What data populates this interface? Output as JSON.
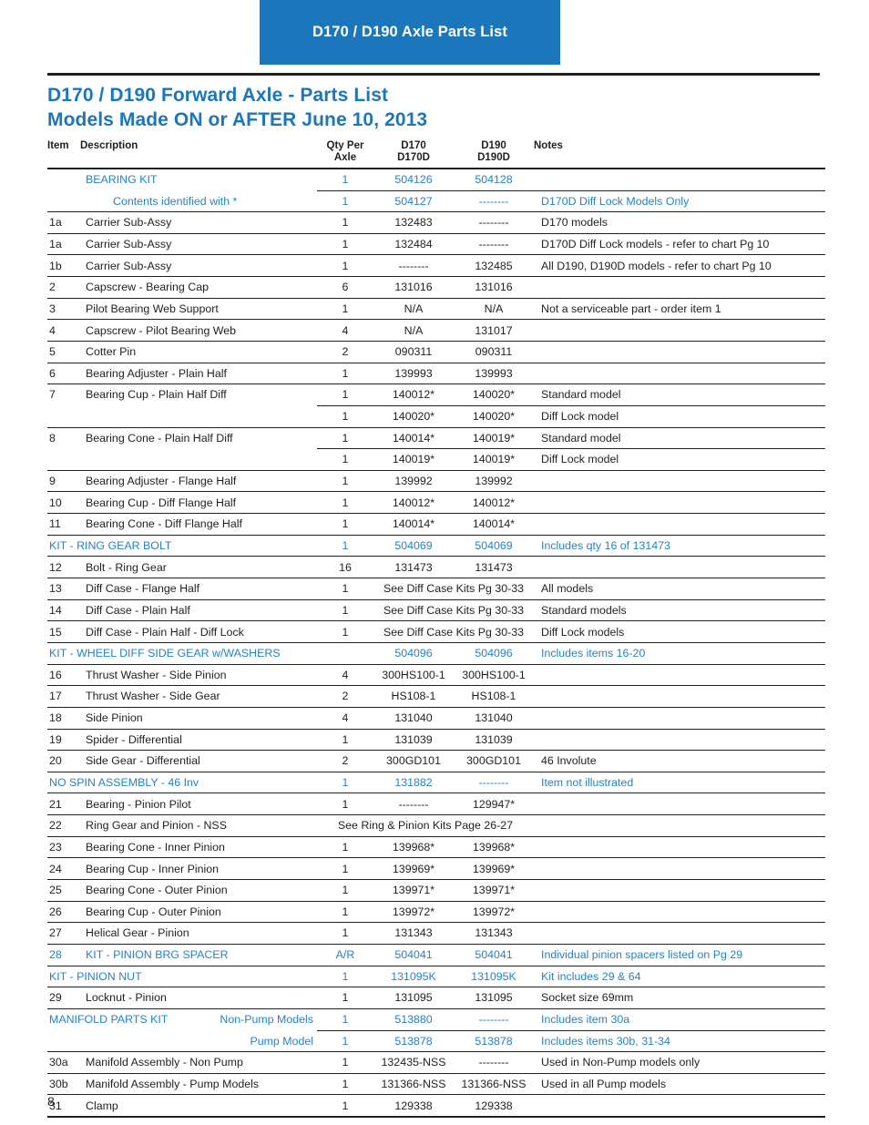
{
  "banner": {
    "title": "D170 / D190 Axle Parts List"
  },
  "document": {
    "title_line1": "D170 / D190 Forward Axle - Parts List",
    "title_line2": "Models Made ON or AFTER June 10, 2013",
    "page_number": "8",
    "accent_blue": "#1b76bc",
    "link_blue": "#2583c6",
    "rule_color": "#231f20"
  },
  "table": {
    "headers": {
      "item": "Item",
      "description": "Description",
      "qty_line1": "Qty Per",
      "qty_line2": "Axle",
      "d170_line1": "D170",
      "d170_line2": "D170D",
      "d190_line1": "D190",
      "d190_line2": "D190D",
      "notes": "Notes"
    },
    "rows": [
      {
        "item": "",
        "desc": "BEARING KIT",
        "qty": "1",
        "d170": "504126",
        "d190": "504128",
        "notes": "",
        "kit": true,
        "left_rule": false
      },
      {
        "item": "",
        "desc": "Contents identified with *",
        "qty": "1",
        "d170": "504127",
        "d190": "--------",
        "notes": "D170D Diff Lock Models Only",
        "kit": true,
        "indent": true
      },
      {
        "item": "1a",
        "desc": "Carrier Sub-Assy",
        "qty": "1",
        "d170": "132483",
        "d190": "--------",
        "notes": "D170 models"
      },
      {
        "item": "1a",
        "desc": "Carrier Sub-Assy",
        "qty": "1",
        "d170": "132484",
        "d190": "--------",
        "notes": "D170D Diff Lock models - refer to chart Pg 10"
      },
      {
        "item": "1b",
        "desc": "Carrier Sub-Assy",
        "qty": "1",
        "d170": "--------",
        "d190": "132485",
        "notes": "All D190, D190D models - refer to chart Pg 10"
      },
      {
        "item": "2",
        "desc": "Capscrew - Bearing Cap",
        "qty": "6",
        "d170": "131016",
        "d190": "131016",
        "notes": ""
      },
      {
        "item": "3",
        "desc": "Pilot Bearing Web Support",
        "qty": "1",
        "d170": "N/A",
        "d190": "N/A",
        "notes": "Not a serviceable part - order item 1"
      },
      {
        "item": "4",
        "desc": "Capscrew - Pilot Bearing Web",
        "qty": "4",
        "d170": "N/A",
        "d190": "131017",
        "notes": ""
      },
      {
        "item": "5",
        "desc": "Cotter Pin",
        "qty": "2",
        "d170": "090311",
        "d190": "090311",
        "notes": ""
      },
      {
        "item": "6",
        "desc": "Bearing Adjuster - Plain Half",
        "qty": "1",
        "d170": "139993",
        "d190": "139993",
        "notes": ""
      },
      {
        "item": "7",
        "desc": "Bearing Cup - Plain Half Diff",
        "qty": "1",
        "d170": "140012*",
        "d190": "140020*",
        "notes": "Standard model",
        "left_rule": false
      },
      {
        "item": "",
        "desc": "",
        "qty": "1",
        "d170": "140020*",
        "d190": "140020*",
        "notes": "Diff Lock model"
      },
      {
        "item": "8",
        "desc": "Bearing Cone - Plain Half Diff",
        "qty": "1",
        "d170": "140014*",
        "d190": "140019*",
        "notes": "Standard model",
        "left_rule": false
      },
      {
        "item": "",
        "desc": "",
        "qty": "1",
        "d170": "140019*",
        "d190": "140019*",
        "notes": "Diff Lock model"
      },
      {
        "item": "9",
        "desc": "Bearing Adjuster - Flange Half",
        "qty": "1",
        "d170": "139992",
        "d190": "139992",
        "notes": ""
      },
      {
        "item": "10",
        "desc": "Bearing Cup - Diff Flange Half",
        "qty": "1",
        "d170": "140012*",
        "d190": "140012*",
        "notes": ""
      },
      {
        "item": "11",
        "desc": "Bearing Cone - Diff Flange Half",
        "qty": "1",
        "d170": "140014*",
        "d190": "140014*",
        "notes": ""
      },
      {
        "item": "",
        "desc": "KIT - RING GEAR BOLT",
        "qty": "1",
        "d170": "504069",
        "d190": "504069",
        "notes": "Includes qty 16 of 131473",
        "kit": true,
        "desc_from_item": true
      },
      {
        "item": "12",
        "desc": "Bolt - Ring Gear",
        "qty": "16",
        "d170": "131473",
        "d190": "131473",
        "notes": ""
      },
      {
        "item": "13",
        "desc": "Diff Case - Flange Half",
        "qty": "1",
        "span_pn": "See Diff Case Kits Pg 30-33",
        "notes": "All models"
      },
      {
        "item": "14",
        "desc": "Diff Case - Plain Half",
        "qty": "1",
        "span_pn": "See Diff Case Kits Pg 30-33",
        "notes": "Standard models"
      },
      {
        "item": "15",
        "desc": "Diff Case - Plain Half - Diff Lock",
        "qty": "1",
        "span_pn": "See Diff Case Kits Pg 30-33",
        "notes": "Diff Lock models"
      },
      {
        "item": "",
        "desc": "KIT - WHEEL DIFF SIDE GEAR w/WASHERS",
        "qty": "",
        "d170": "504096",
        "d190": "504096",
        "notes": "Includes items 16-20",
        "kit": true,
        "desc_from_item": true
      },
      {
        "item": "16",
        "desc": "Thrust Washer - Side Pinion",
        "qty": "4",
        "d170": "300HS100-1",
        "d190": "300HS100-1",
        "notes": ""
      },
      {
        "item": "17",
        "desc": "Thrust Washer - Side Gear",
        "qty": "2",
        "d170": "HS108-1",
        "d190": "HS108-1",
        "notes": ""
      },
      {
        "item": "18",
        "desc": "Side Pinion",
        "qty": "4",
        "d170": "131040",
        "d190": "131040",
        "notes": ""
      },
      {
        "item": "19",
        "desc": "Spider - Differential",
        "qty": "1",
        "d170": "131039",
        "d190": "131039",
        "notes": ""
      },
      {
        "item": "20",
        "desc": "Side Gear - Differential",
        "qty": "2",
        "d170": "300GD101",
        "d190": "300GD101",
        "notes": "46 Involute"
      },
      {
        "item": "",
        "desc": "NO SPIN ASSEMBLY - 46 Inv",
        "qty": "1",
        "d170": "131882",
        "d190": "--------",
        "notes": "Item not illustrated",
        "kit": true,
        "desc_from_item": true
      },
      {
        "item": "21",
        "desc": "Bearing - Pinion Pilot",
        "qty": "1",
        "d170": "--------",
        "d190": "129947*",
        "notes": ""
      },
      {
        "item": "22",
        "desc": "Ring Gear and Pinion - NSS",
        "qty": "",
        "span_wide": "See Ring & Pinion Kits Page 26-27",
        "notes": ""
      },
      {
        "item": "23",
        "desc": "Bearing Cone - Inner Pinion",
        "qty": "1",
        "d170": "139968*",
        "d190": "139968*",
        "notes": ""
      },
      {
        "item": "24",
        "desc": "Bearing Cup - Inner Pinion",
        "qty": "1",
        "d170": "139969*",
        "d190": "139969*",
        "notes": ""
      },
      {
        "item": "25",
        "desc": "Bearing Cone - Outer Pinion",
        "qty": "1",
        "d170": "139971*",
        "d190": "139971*",
        "notes": ""
      },
      {
        "item": "26",
        "desc": "Bearing Cup - Outer Pinion",
        "qty": "1",
        "d170": "139972*",
        "d190": "139972*",
        "notes": ""
      },
      {
        "item": "27",
        "desc": "Helical Gear - Pinion",
        "qty": "1",
        "d170": "131343",
        "d190": "131343",
        "notes": ""
      },
      {
        "item": "28",
        "desc": "KIT - PINION BRG SPACER",
        "qty": "A/R",
        "d170": "504041",
        "d190": "504041",
        "notes": "Individual pinion spacers listed on Pg 29",
        "kit": true
      },
      {
        "item": "",
        "desc": "KIT - PINION NUT",
        "qty": "1",
        "d170": "131095K",
        "d190": "131095K",
        "notes": "Kit includes  29 & 64",
        "kit": true,
        "desc_from_item": true
      },
      {
        "item": "29",
        "desc": "Locknut - Pinion",
        "qty": "1",
        "d170": "131095",
        "d190": "131095",
        "notes": "Socket size 69mm"
      },
      {
        "item": "",
        "desc": "MANIFOLD PARTS KIT",
        "desc_right": "Non-Pump Models",
        "qty": "1",
        "d170": "513880",
        "d190": "--------",
        "notes": "Includes item 30a",
        "kit": true,
        "desc_from_item": true,
        "left_rule": false
      },
      {
        "item": "",
        "desc": "",
        "desc_right": "Pump Model",
        "qty": "1",
        "d170": "513878",
        "d190": "513878",
        "notes": "Includes items 30b, 31-34",
        "kit": true,
        "desc_from_item": true
      },
      {
        "item": "30a",
        "desc": "Manifold Assembly - Non Pump",
        "qty": "1",
        "d170": "132435-NSS",
        "d190": "--------",
        "notes": "Used in Non-Pump models only"
      },
      {
        "item": "30b",
        "desc": "Manifold Assembly - Pump Models",
        "qty": "1",
        "d170": "131366-NSS",
        "d190": "131366-NSS",
        "notes": "Used in all Pump models"
      },
      {
        "item": "31",
        "desc": "Clamp",
        "qty": "1",
        "d170": "129338",
        "d190": "129338",
        "notes": ""
      }
    ]
  }
}
